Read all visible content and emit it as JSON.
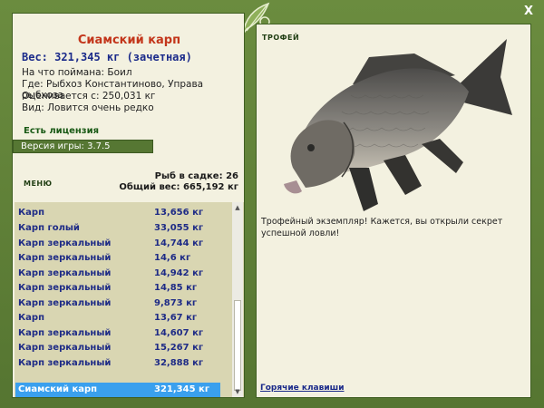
{
  "window": {
    "close_label": "X"
  },
  "catch": {
    "name": "Сиамский карп",
    "weight_line": "Вес: 321,345 кг (зачетная)",
    "bait": "На что поймана: Боил",
    "location": "Где: Рыбхоз Константиново, Управа рыбхоза",
    "valued": "Оценивается с: 250,031 кг",
    "rarity": "Вид: Ловится очень редко"
  },
  "license": "Есть лицензия",
  "version": "Версия игры: 3.7.5",
  "menu_label": "МЕНЮ",
  "cage": {
    "count_line": "Рыб в садке: 26",
    "total_line": "Общий вес: 665,192 кг"
  },
  "fish_list": [
    {
      "name": "Карп",
      "weight": "13,656 кг"
    },
    {
      "name": "Карп голый",
      "weight": "33,055 кг"
    },
    {
      "name": "Карп зеркальный",
      "weight": "14,744 кг"
    },
    {
      "name": "Карп зеркальный",
      "weight": "14,6 кг"
    },
    {
      "name": "Карп зеркальный",
      "weight": "14,942 кг"
    },
    {
      "name": "Карп зеркальный",
      "weight": "14,85 кг"
    },
    {
      "name": "Карп зеркальный",
      "weight": "9,873 кг"
    },
    {
      "name": "Карп",
      "weight": "13,67 кг"
    },
    {
      "name": "Карп зеркальный",
      "weight": "14,607 кг"
    },
    {
      "name": "Карп зеркальный",
      "weight": "15,267 кг"
    },
    {
      "name": "Карп зеркальный",
      "weight": "32,888 кг"
    },
    {
      "name": "Сиамский карп",
      "weight": "321,345 кг",
      "selected": true
    }
  ],
  "trophy": {
    "title": "ТРОФЕЙ",
    "text": "Трофейный экземпляр! Кажется, вы открыли секрет успешной ловли!",
    "hotkeys": "Горячие клавиши"
  },
  "colors": {
    "frame": "#5c7d36",
    "panel": "#f3f1e0",
    "list_bg": "#d9d6b2",
    "selected": "#3aa0ee",
    "title_red": "#c3361b",
    "text_blue": "#1a2a8a"
  }
}
